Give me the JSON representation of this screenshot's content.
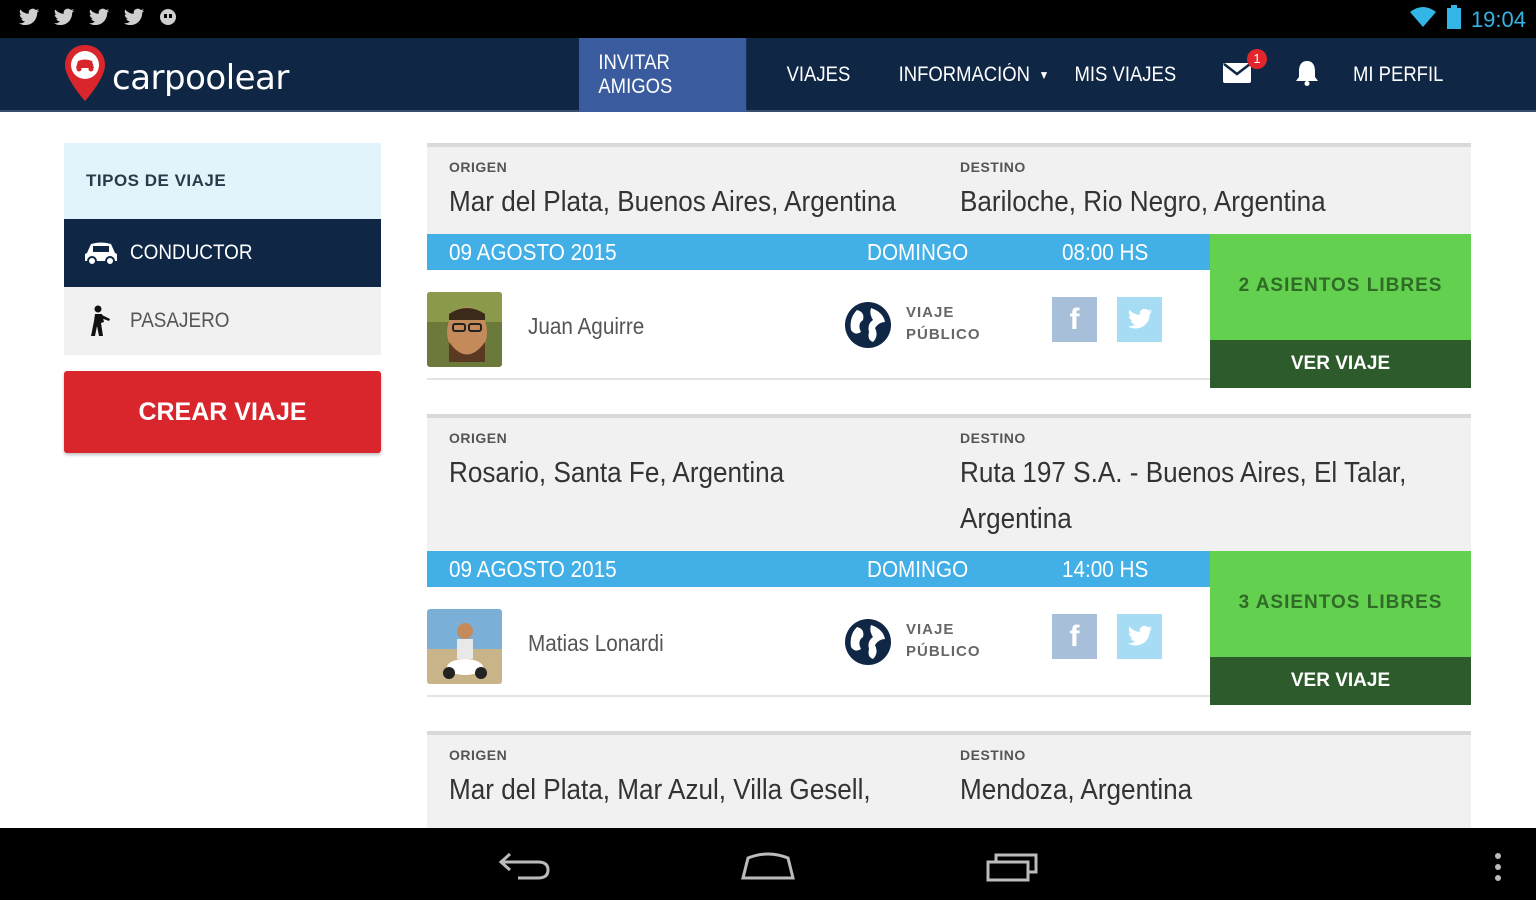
{
  "status_bar": {
    "time": "19:04",
    "notification_icons": [
      "twitter-icon",
      "twitter-icon",
      "twitter-icon",
      "twitter-icon",
      "hangouts-icon"
    ],
    "system_icons": [
      "wifi-icon",
      "battery-icon"
    ]
  },
  "nav": {
    "brand": "carpoolear",
    "items": [
      {
        "label": "INVITAR AMIGOS",
        "active": true
      },
      {
        "label": "VIAJES"
      },
      {
        "label": "INFORMACIÓN"
      },
      {
        "label": "MIS VIAJES"
      },
      {
        "label": "MI PERFIL"
      }
    ],
    "mail_badge": "1",
    "icons": [
      "mail-icon",
      "bell-icon",
      "chevron-down-icon"
    ]
  },
  "sidebar": {
    "header": "TIPOS DE VIAJE",
    "items": [
      {
        "label": "CONDUCTOR",
        "icon": "car-icon",
        "active": true
      },
      {
        "label": "PASAJERO",
        "icon": "hitchhiker-icon",
        "active": false
      }
    ],
    "create_button": "CREAR VIAJE"
  },
  "trips": [
    {
      "origin_label": "ORIGEN",
      "origin": "Mar del Plata, Buenos Aires, Argentina",
      "dest_label": "DESTINO",
      "dest": "Bariloche, Rio Negro, Argentina",
      "date": "09 AGOSTO 2015",
      "day": "DOMINGO",
      "time": "08:00 HS",
      "driver": "Juan Aguirre",
      "visibility_line1": "VIAJE",
      "visibility_line2": "PÚBLICO",
      "seats": "2 ASIENTOS LIBRES",
      "action": "VER VIAJE"
    },
    {
      "origin_label": "ORIGEN",
      "origin": "Rosario, Santa Fe, Argentina",
      "dest_label": "DESTINO",
      "dest": "Ruta 197 S.A. - Buenos Aires, El Talar, Argentina",
      "date": "09 AGOSTO 2015",
      "day": "DOMINGO",
      "time": "14:00 HS",
      "driver": "Matias Lonardi",
      "visibility_line1": "VIAJE",
      "visibility_line2": "PÚBLICO",
      "seats": "3 ASIENTOS LIBRES",
      "action": "VER VIAJE"
    },
    {
      "origin_label": "ORIGEN",
      "origin": "Mar del Plata, Mar Azul, Villa Gesell,",
      "dest_label": "DESTINO",
      "dest": "Mendoza, Argentina"
    }
  ],
  "colors": {
    "navbar": "#0f2745",
    "nav_active": "#3a5c9e",
    "date_bar": "#42b0e6",
    "seats": "#63d14f",
    "ver_viaje": "#2d5b2b",
    "create": "#d9262c"
  }
}
